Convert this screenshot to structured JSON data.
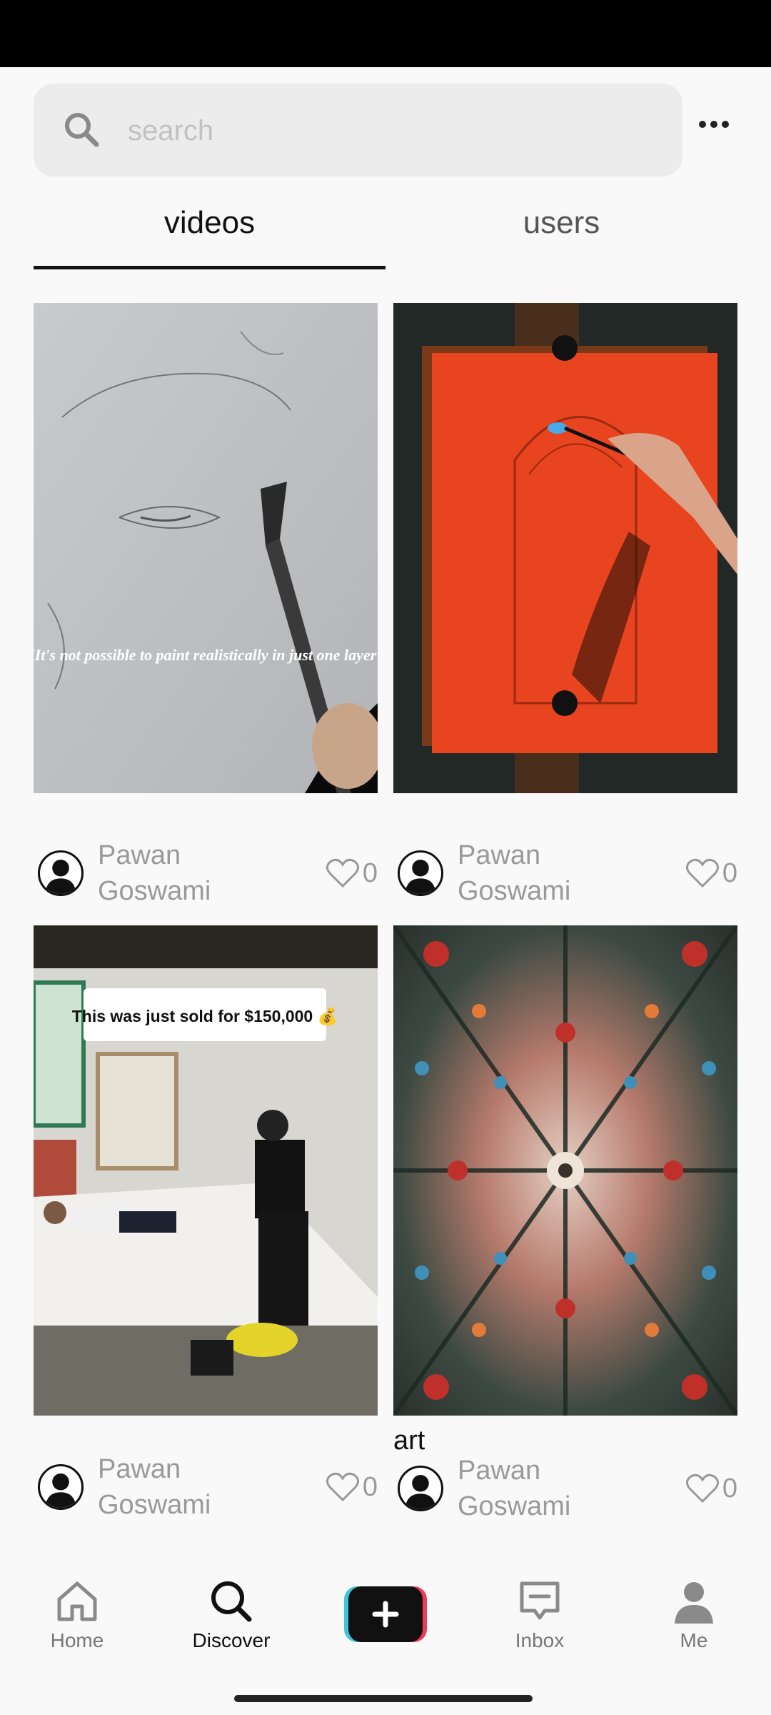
{
  "search": {
    "placeholder": "search"
  },
  "tabs": [
    {
      "label": "videos",
      "active": true
    },
    {
      "label": "users",
      "active": false
    }
  ],
  "videos": [
    {
      "overlay_text": "'It's not possible to paint realistically in just one layer'",
      "caption": "",
      "author": "Pawan Goswami",
      "likes": "0"
    },
    {
      "overlay_text": "",
      "caption": "",
      "author": "Pawan Goswami",
      "likes": "0"
    },
    {
      "overlay_text": "This was just sold for $150,000 💰",
      "caption": "",
      "author": "Pawan Goswami",
      "likes": "0"
    },
    {
      "overlay_text": "",
      "caption": "art",
      "author": "Pawan Goswami",
      "likes": "0"
    }
  ],
  "nav": {
    "home": "Home",
    "discover": "Discover",
    "inbox": "Inbox",
    "me": "Me",
    "active": "discover"
  },
  "colors": {
    "accent_left": "#3ec6d8",
    "accent_right": "#ee3b5b",
    "create_bg": "#111111"
  }
}
